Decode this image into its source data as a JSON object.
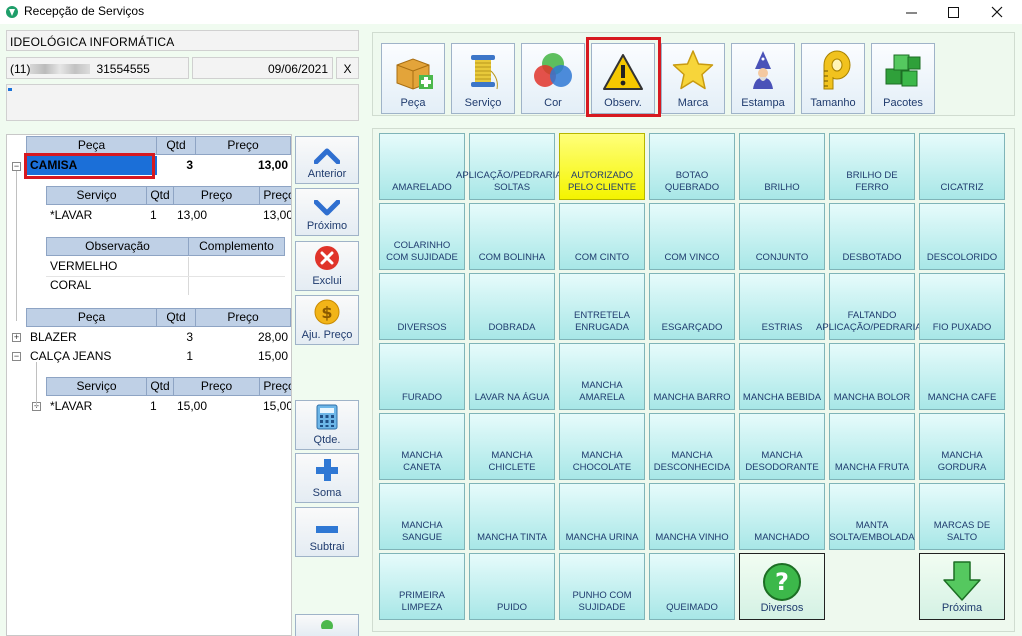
{
  "window": {
    "title": "Recepção de Serviços",
    "minimize": "—",
    "maximize": "☐",
    "close": "✕"
  },
  "header": {
    "client_name": "IDEOLÓGICA INFORMÁTICA",
    "phone_prefix": "(11)",
    "phone_suffix": "31554555",
    "date": "09/06/2021",
    "clear_label": "X",
    "progress_fraction": 0.01
  },
  "tree": {
    "items_header": {
      "piece": "Peça",
      "qty": "Qtd",
      "price": "Preço"
    },
    "item1": {
      "name": "CAMISA",
      "qty": "3",
      "price": "13,00"
    },
    "item1_services_header": {
      "service": "Serviço",
      "qty": "Qtd",
      "price": "Preço",
      "price2": "Preço"
    },
    "item1_service_row": {
      "service": "*LAVAR",
      "qty": "1",
      "price": "13,00",
      "price2": "13,00"
    },
    "obs_header": {
      "obs": "Observação",
      "complement": "Complemento"
    },
    "obs_rows": [
      "VERMELHO",
      "CORAL"
    ],
    "items_header2": {
      "piece": "Peça",
      "qty": "Qtd",
      "price": "Preço"
    },
    "item2": {
      "name": "BLAZER",
      "qty": "3",
      "price": "28,00"
    },
    "item3": {
      "name": "CALÇA JEANS",
      "qty": "1",
      "price": "15,00"
    },
    "item3_services_header": {
      "service": "Serviço",
      "qty": "Qtd",
      "price": "Preço",
      "price2": "Preço"
    },
    "item3_service_row": {
      "service": "*LAVAR",
      "qty": "1",
      "price": "15,00",
      "price2": "15,00"
    }
  },
  "side_buttons": {
    "previous": "Anterior",
    "next": "Próximo",
    "delete": "Exclui",
    "adjust_price": "Aju. Preço",
    "quantity": "Qtde.",
    "add": "Soma",
    "subtract": "Subtrai"
  },
  "toolbar": {
    "items": [
      {
        "label": "Peça",
        "icon": "box-add-icon"
      },
      {
        "label": "Serviço",
        "icon": "thread-spool-icon"
      },
      {
        "label": "Cor",
        "icon": "color-circles-icon"
      },
      {
        "label": "Observ.",
        "icon": "warning-icon"
      },
      {
        "label": "Marca",
        "icon": "star-icon"
      },
      {
        "label": "Estampa",
        "icon": "wizard-icon"
      },
      {
        "label": "Tamanho",
        "icon": "measuring-tape-icon"
      },
      {
        "label": "Pacotes",
        "icon": "cubes-icon"
      }
    ]
  },
  "observations": [
    "AMARELADO",
    "APLICAÇÃO/PEDRARIAS SOLTAS",
    "AUTORIZADO PELO CLIENTE",
    "BOTAO QUEBRADO",
    "BRILHO",
    "BRILHO DE FERRO",
    "CICATRIZ",
    "COLARINHO COM SUJIDADE",
    "COM BOLINHA",
    "COM CINTO",
    "COM VINCO",
    "CONJUNTO",
    "DESBOTADO",
    "DESCOLORIDO",
    "DIVERSOS",
    "DOBRADA",
    "ENTRETELA ENRUGADA",
    "ESGARÇADO",
    "ESTRIAS",
    "FALTANDO APLICAÇÃO/PEDRARIAS",
    "FIO PUXADO",
    "FURADO",
    "LAVAR NA ÁGUA",
    "MANCHA AMARELA",
    "MANCHA BARRO",
    "MANCHA BEBIDA",
    "MANCHA BOLOR",
    "MANCHA CAFE",
    "MANCHA CANETA",
    "MANCHA CHICLETE",
    "MANCHA CHOCOLATE",
    "MANCHA DESCONHECIDA",
    "MANCHA DESODORANTE",
    "MANCHA FRUTA",
    "MANCHA GORDURA",
    "MANCHA SANGUE",
    "MANCHA TINTA",
    "MANCHA URINA",
    "MANCHA VINHO",
    "MANCHADO",
    "MANTA SOLTA/EMBOLADA",
    "MARCAS DE SALTO",
    "PRIMEIRA LIMPEZA",
    "PUIDO",
    "PUNHO COM SUJIDADE",
    "QUEIMADO"
  ],
  "observation_selected": "AUTORIZADO PELO CLIENTE",
  "special_buttons": {
    "misc": "Diversos",
    "next_page": "Próxima"
  },
  "colors": {
    "selection": "#1b6fd8",
    "highlight": "#d71920",
    "cell": "#a8e7e7",
    "cell_selected": "#f4f400"
  }
}
